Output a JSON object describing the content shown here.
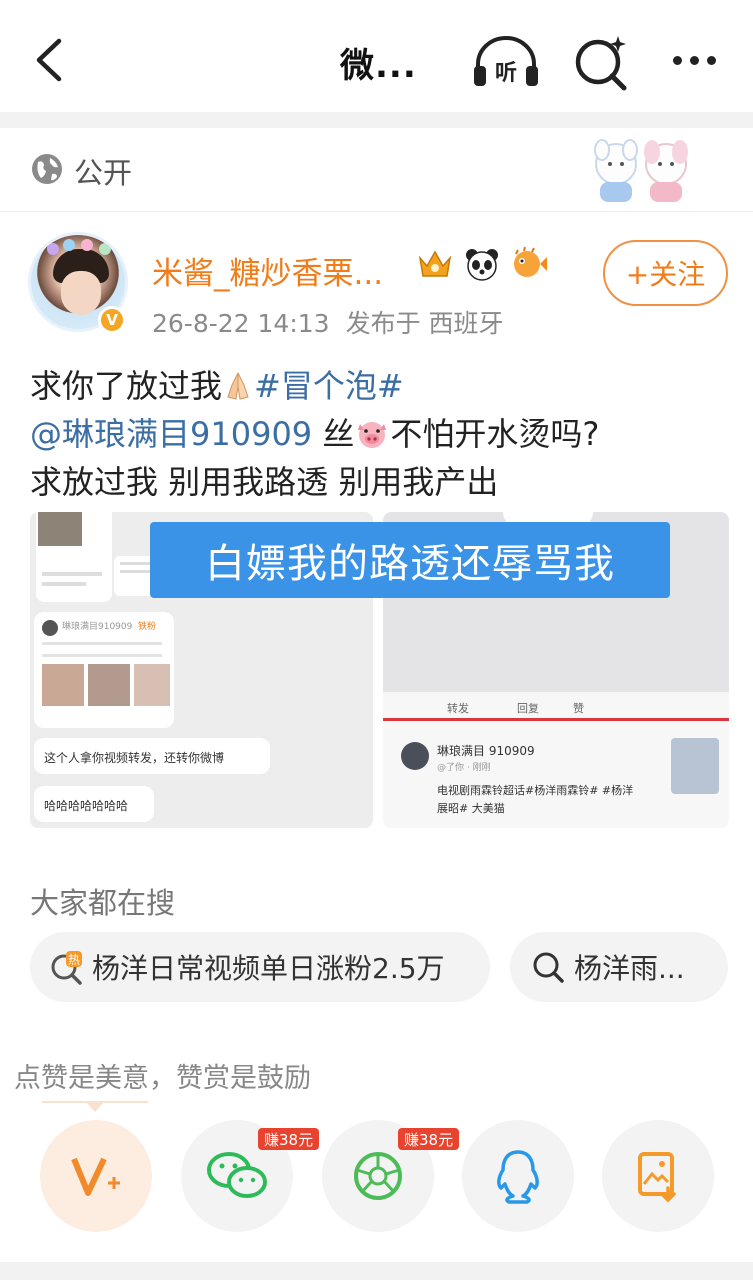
{
  "nav": {
    "title": "微...",
    "listen_label": "听"
  },
  "visibility": {
    "label": "公开"
  },
  "post": {
    "username": "米酱_糖炒香栗...",
    "verified_mark": "V",
    "timestamp": "26-8-22 14:13",
    "published_from": "发布于 西班牙",
    "follow_label": "+关注",
    "text_line1_prefix": "求你了放过我",
    "topic": "#冒个泡#",
    "mention": "@琳琅满目910909",
    "text_line2_mid": " 丝",
    "text_line2_suffix": "不怕开水烫吗?",
    "text_line3": "求放过我 别用我路透 别用我产出",
    "image_caption": "白嫖我的路透还辱骂我"
  },
  "left_image": {
    "card_user": "琳琅满目910909",
    "card_tag": "铁粉",
    "comment1": "这个人拿你视频转发，还转你微博",
    "comment2": "哈哈哈哈哈哈哈"
  },
  "right_image": {
    "repost": "转发",
    "comment": "回复",
    "like": "赞",
    "card_user": "琳琅满目 910909",
    "card_time": "@了你 · 刚刚",
    "card_text_line1": "电视剧雨霖铃超话#杨洋雨霖铃# #杨洋",
    "card_text_line2": "展昭# 大美猫"
  },
  "searches": {
    "heading": "大家都在搜",
    "chips": [
      {
        "label": "杨洋日常视频单日涨粉2.5万",
        "icon": "hot-search-icon"
      },
      {
        "label": "杨洋雨...",
        "icon": "search-icon"
      }
    ]
  },
  "reward": {
    "label": "点赞是美意，赞赏是鼓励",
    "earn_badge_1": "赚38元",
    "earn_badge_2": "赚38元",
    "buttons": [
      "v-plus-icon",
      "wechat-icon",
      "moments-icon",
      "qq-icon",
      "save-image-icon"
    ]
  },
  "colors": {
    "accent_orange": "#f07c1a",
    "link_blue": "#3a6ea5",
    "caption_blue": "#3b93e8",
    "earn_red": "#e8432e"
  }
}
